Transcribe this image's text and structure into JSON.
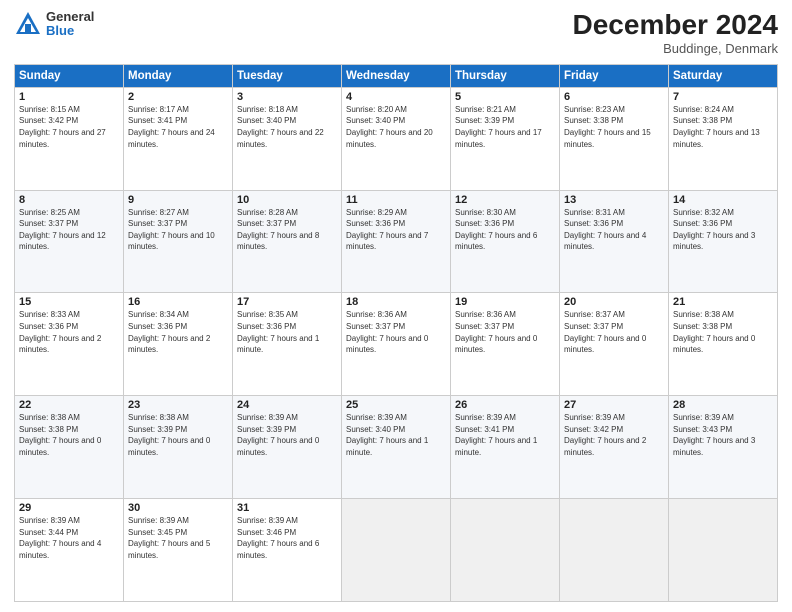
{
  "logo": {
    "general": "General",
    "blue": "Blue"
  },
  "header": {
    "month": "December 2024",
    "location": "Buddinge, Denmark"
  },
  "days_of_week": [
    "Sunday",
    "Monday",
    "Tuesday",
    "Wednesday",
    "Thursday",
    "Friday",
    "Saturday"
  ],
  "weeks": [
    [
      {
        "day": "1",
        "sunrise": "Sunrise: 8:15 AM",
        "sunset": "Sunset: 3:42 PM",
        "daylight": "Daylight: 7 hours and 27 minutes."
      },
      {
        "day": "2",
        "sunrise": "Sunrise: 8:17 AM",
        "sunset": "Sunset: 3:41 PM",
        "daylight": "Daylight: 7 hours and 24 minutes."
      },
      {
        "day": "3",
        "sunrise": "Sunrise: 8:18 AM",
        "sunset": "Sunset: 3:40 PM",
        "daylight": "Daylight: 7 hours and 22 minutes."
      },
      {
        "day": "4",
        "sunrise": "Sunrise: 8:20 AM",
        "sunset": "Sunset: 3:40 PM",
        "daylight": "Daylight: 7 hours and 20 minutes."
      },
      {
        "day": "5",
        "sunrise": "Sunrise: 8:21 AM",
        "sunset": "Sunset: 3:39 PM",
        "daylight": "Daylight: 7 hours and 17 minutes."
      },
      {
        "day": "6",
        "sunrise": "Sunrise: 8:23 AM",
        "sunset": "Sunset: 3:38 PM",
        "daylight": "Daylight: 7 hours and 15 minutes."
      },
      {
        "day": "7",
        "sunrise": "Sunrise: 8:24 AM",
        "sunset": "Sunset: 3:38 PM",
        "daylight": "Daylight: 7 hours and 13 minutes."
      }
    ],
    [
      {
        "day": "8",
        "sunrise": "Sunrise: 8:25 AM",
        "sunset": "Sunset: 3:37 PM",
        "daylight": "Daylight: 7 hours and 12 minutes."
      },
      {
        "day": "9",
        "sunrise": "Sunrise: 8:27 AM",
        "sunset": "Sunset: 3:37 PM",
        "daylight": "Daylight: 7 hours and 10 minutes."
      },
      {
        "day": "10",
        "sunrise": "Sunrise: 8:28 AM",
        "sunset": "Sunset: 3:37 PM",
        "daylight": "Daylight: 7 hours and 8 minutes."
      },
      {
        "day": "11",
        "sunrise": "Sunrise: 8:29 AM",
        "sunset": "Sunset: 3:36 PM",
        "daylight": "Daylight: 7 hours and 7 minutes."
      },
      {
        "day": "12",
        "sunrise": "Sunrise: 8:30 AM",
        "sunset": "Sunset: 3:36 PM",
        "daylight": "Daylight: 7 hours and 6 minutes."
      },
      {
        "day": "13",
        "sunrise": "Sunrise: 8:31 AM",
        "sunset": "Sunset: 3:36 PM",
        "daylight": "Daylight: 7 hours and 4 minutes."
      },
      {
        "day": "14",
        "sunrise": "Sunrise: 8:32 AM",
        "sunset": "Sunset: 3:36 PM",
        "daylight": "Daylight: 7 hours and 3 minutes."
      }
    ],
    [
      {
        "day": "15",
        "sunrise": "Sunrise: 8:33 AM",
        "sunset": "Sunset: 3:36 PM",
        "daylight": "Daylight: 7 hours and 2 minutes."
      },
      {
        "day": "16",
        "sunrise": "Sunrise: 8:34 AM",
        "sunset": "Sunset: 3:36 PM",
        "daylight": "Daylight: 7 hours and 2 minutes."
      },
      {
        "day": "17",
        "sunrise": "Sunrise: 8:35 AM",
        "sunset": "Sunset: 3:36 PM",
        "daylight": "Daylight: 7 hours and 1 minute."
      },
      {
        "day": "18",
        "sunrise": "Sunrise: 8:36 AM",
        "sunset": "Sunset: 3:37 PM",
        "daylight": "Daylight: 7 hours and 0 minutes."
      },
      {
        "day": "19",
        "sunrise": "Sunrise: 8:36 AM",
        "sunset": "Sunset: 3:37 PM",
        "daylight": "Daylight: 7 hours and 0 minutes."
      },
      {
        "day": "20",
        "sunrise": "Sunrise: 8:37 AM",
        "sunset": "Sunset: 3:37 PM",
        "daylight": "Daylight: 7 hours and 0 minutes."
      },
      {
        "day": "21",
        "sunrise": "Sunrise: 8:38 AM",
        "sunset": "Sunset: 3:38 PM",
        "daylight": "Daylight: 7 hours and 0 minutes."
      }
    ],
    [
      {
        "day": "22",
        "sunrise": "Sunrise: 8:38 AM",
        "sunset": "Sunset: 3:38 PM",
        "daylight": "Daylight: 7 hours and 0 minutes."
      },
      {
        "day": "23",
        "sunrise": "Sunrise: 8:38 AM",
        "sunset": "Sunset: 3:39 PM",
        "daylight": "Daylight: 7 hours and 0 minutes."
      },
      {
        "day": "24",
        "sunrise": "Sunrise: 8:39 AM",
        "sunset": "Sunset: 3:39 PM",
        "daylight": "Daylight: 7 hours and 0 minutes."
      },
      {
        "day": "25",
        "sunrise": "Sunrise: 8:39 AM",
        "sunset": "Sunset: 3:40 PM",
        "daylight": "Daylight: 7 hours and 1 minute."
      },
      {
        "day": "26",
        "sunrise": "Sunrise: 8:39 AM",
        "sunset": "Sunset: 3:41 PM",
        "daylight": "Daylight: 7 hours and 1 minute."
      },
      {
        "day": "27",
        "sunrise": "Sunrise: 8:39 AM",
        "sunset": "Sunset: 3:42 PM",
        "daylight": "Daylight: 7 hours and 2 minutes."
      },
      {
        "day": "28",
        "sunrise": "Sunrise: 8:39 AM",
        "sunset": "Sunset: 3:43 PM",
        "daylight": "Daylight: 7 hours and 3 minutes."
      }
    ],
    [
      {
        "day": "29",
        "sunrise": "Sunrise: 8:39 AM",
        "sunset": "Sunset: 3:44 PM",
        "daylight": "Daylight: 7 hours and 4 minutes."
      },
      {
        "day": "30",
        "sunrise": "Sunrise: 8:39 AM",
        "sunset": "Sunset: 3:45 PM",
        "daylight": "Daylight: 7 hours and 5 minutes."
      },
      {
        "day": "31",
        "sunrise": "Sunrise: 8:39 AM",
        "sunset": "Sunset: 3:46 PM",
        "daylight": "Daylight: 7 hours and 6 minutes."
      },
      null,
      null,
      null,
      null
    ]
  ]
}
